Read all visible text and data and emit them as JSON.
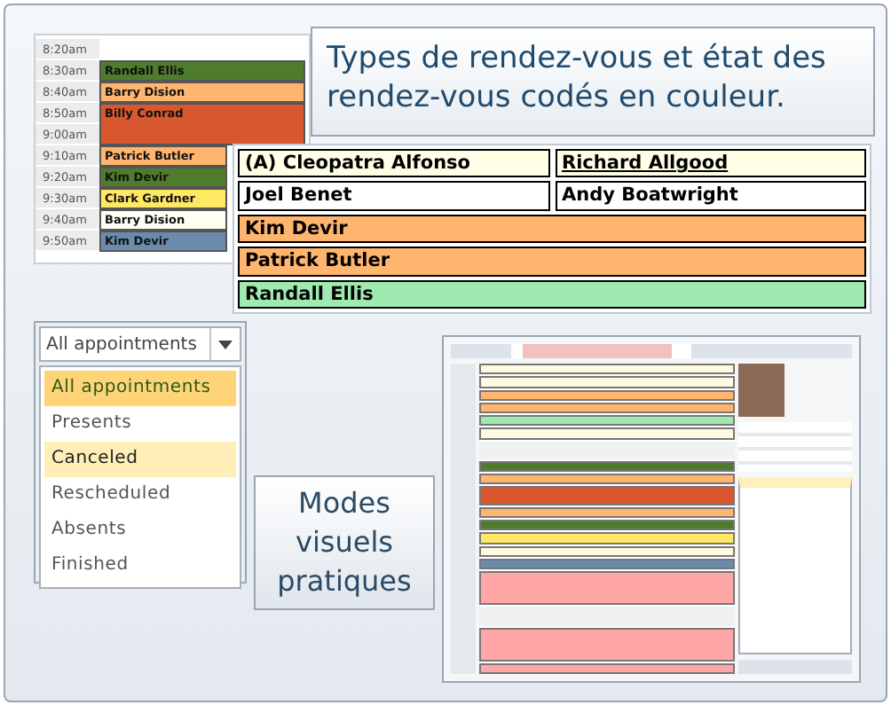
{
  "calendar": {
    "slots": [
      {
        "time": "8:20am"
      },
      {
        "time": "8:30am",
        "appointment": {
          "name": "Randall Ellis",
          "color": "#4f7b2c"
        }
      },
      {
        "time": "8:40am",
        "appointment": {
          "name": "Barry Dision",
          "color": "#ffb56e"
        }
      },
      {
        "time": "8:50am",
        "appointment": {
          "name": "Billy Conrad",
          "color": "#d9572f"
        }
      },
      {
        "time": "9:00am",
        "continues": true
      },
      {
        "time": "9:10am",
        "appointment": {
          "name": "Patrick Butler",
          "color": "#ffb56e"
        }
      },
      {
        "time": "9:20am",
        "appointment": {
          "name": "Kim Devir",
          "color": "#4f7b2c"
        }
      },
      {
        "time": "9:30am",
        "appointment": {
          "name": "Clark Gardner",
          "color": "#ffe864"
        }
      },
      {
        "time": "9:40am",
        "appointment": {
          "name": "Barry Dision",
          "color": "#fffff4"
        }
      },
      {
        "time": "9:50am",
        "appointment": {
          "name": "Kim Devir",
          "color": "#6a8bab"
        }
      }
    ]
  },
  "caption": "Types de rendez-vous  et état des rendez-vous codés en couleur.",
  "appointment_list": [
    {
      "color": "#ffffe6",
      "cells": [
        {
          "text": "(A) Cleopatra Alfonso",
          "link": false
        },
        {
          "text": "Richard Allgood",
          "link": true
        }
      ]
    },
    {
      "color": "#ffffff",
      "cells": [
        {
          "text": "Joel Benet",
          "link": false
        },
        {
          "text": "Andy Boatwright",
          "link": false
        }
      ]
    },
    {
      "color": "#ffb56e",
      "cells": [
        {
          "text": "Kim Devir",
          "link": false
        }
      ]
    },
    {
      "color": "#ffb56e",
      "cells": [
        {
          "text": "Patrick Butler",
          "link": false
        }
      ]
    },
    {
      "color": "#9eeab0",
      "cells": [
        {
          "text": "Randall Ellis",
          "link": false
        }
      ]
    }
  ],
  "filter_dropdown": {
    "value": "All appointments",
    "options": [
      {
        "label": "All appointments",
        "selected": true,
        "hovered": false
      },
      {
        "label": "Presents",
        "selected": false,
        "hovered": false
      },
      {
        "label": "Canceled",
        "selected": false,
        "hovered": true
      },
      {
        "label": "Rescheduled",
        "selected": false,
        "hovered": false
      },
      {
        "label": "Absents",
        "selected": false,
        "hovered": false
      },
      {
        "label": "Finished",
        "selected": false,
        "hovered": false
      }
    ]
  },
  "callout": "Modes visuels pratiques"
}
